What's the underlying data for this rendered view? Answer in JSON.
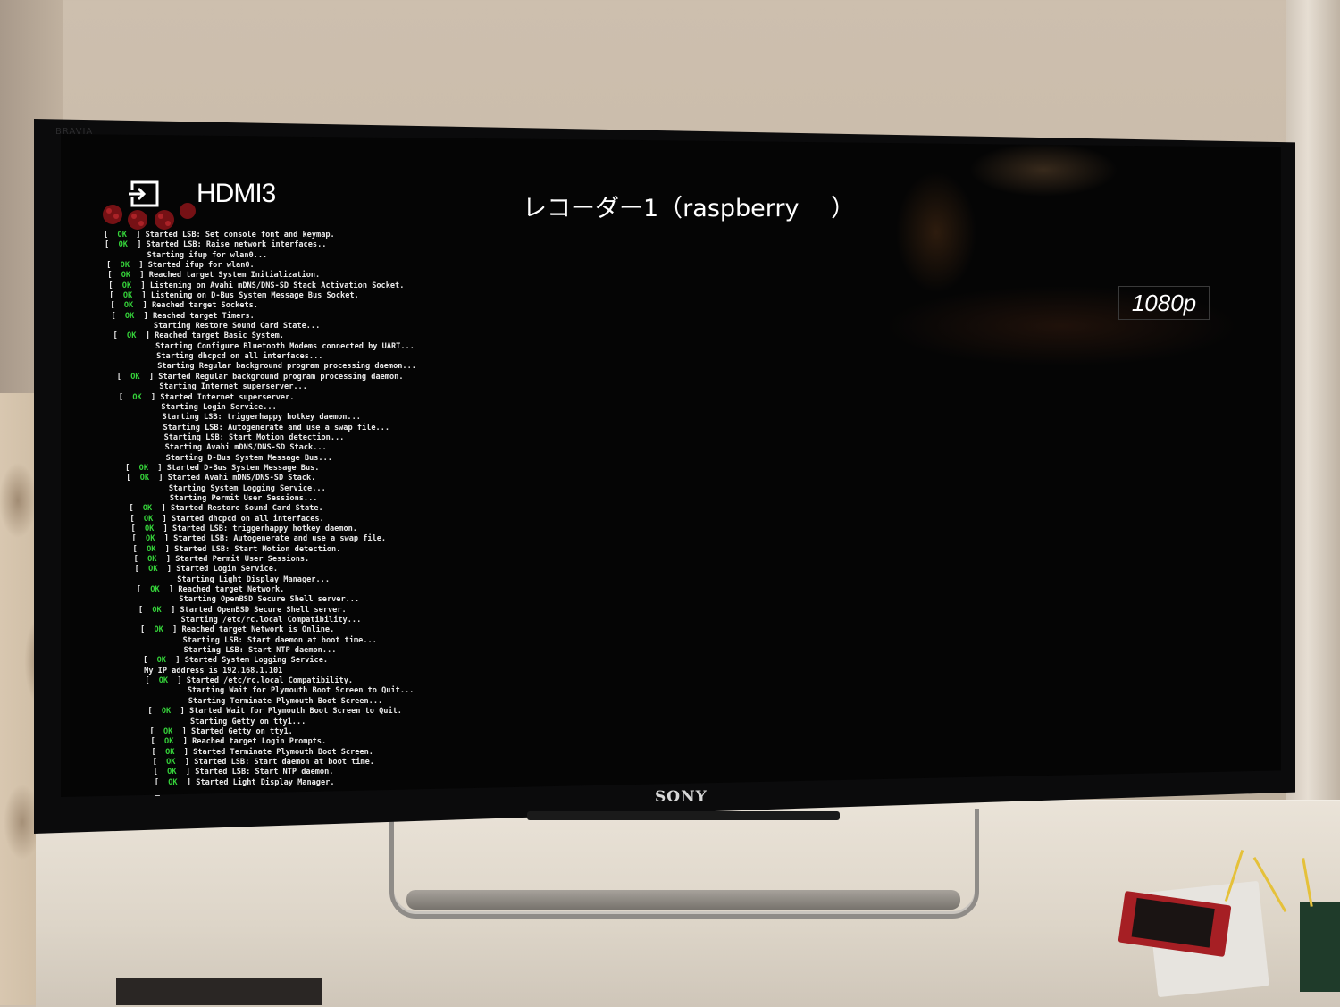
{
  "tv": {
    "brand": "SONY",
    "top_brand": "BRAVIA"
  },
  "osd": {
    "input_label": "HDMI3",
    "channel_title": "レコーダー1（raspberry　 ）",
    "resolution": "1080p",
    "input_icon": "input-source-icon"
  },
  "console": {
    "lines": [
      {
        "ok": true,
        "text": "Started LSB: Set console font and keymap."
      },
      {
        "ok": true,
        "text": "Started LSB: Raise network interfaces.."
      },
      {
        "ok": false,
        "text": "Starting ifup for wlan0..."
      },
      {
        "ok": true,
        "text": "Started ifup for wlan0."
      },
      {
        "ok": true,
        "text": "Reached target System Initialization."
      },
      {
        "ok": true,
        "text": "Listening on Avahi mDNS/DNS-SD Stack Activation Socket."
      },
      {
        "ok": true,
        "text": "Listening on D-Bus System Message Bus Socket."
      },
      {
        "ok": true,
        "text": "Reached target Sockets."
      },
      {
        "ok": true,
        "text": "Reached target Timers."
      },
      {
        "ok": false,
        "text": "Starting Restore Sound Card State..."
      },
      {
        "ok": true,
        "text": "Reached target Basic System."
      },
      {
        "ok": false,
        "text": "Starting Configure Bluetooth Modems connected by UART..."
      },
      {
        "ok": false,
        "text": "Starting dhcpcd on all interfaces..."
      },
      {
        "ok": false,
        "text": "Starting Regular background program processing daemon..."
      },
      {
        "ok": true,
        "text": "Started Regular background program processing daemon."
      },
      {
        "ok": false,
        "text": "Starting Internet superserver..."
      },
      {
        "ok": true,
        "text": "Started Internet superserver."
      },
      {
        "ok": false,
        "text": "Starting Login Service..."
      },
      {
        "ok": false,
        "text": "Starting LSB: triggerhappy hotkey daemon..."
      },
      {
        "ok": false,
        "text": "Starting LSB: Autogenerate and use a swap file..."
      },
      {
        "ok": false,
        "text": "Starting LSB: Start Motion detection..."
      },
      {
        "ok": false,
        "text": "Starting Avahi mDNS/DNS-SD Stack..."
      },
      {
        "ok": false,
        "text": "Starting D-Bus System Message Bus..."
      },
      {
        "ok": true,
        "text": "Started D-Bus System Message Bus."
      },
      {
        "ok": true,
        "text": "Started Avahi mDNS/DNS-SD Stack."
      },
      {
        "ok": false,
        "text": "Starting System Logging Service..."
      },
      {
        "ok": false,
        "text": "Starting Permit User Sessions..."
      },
      {
        "ok": true,
        "text": "Started Restore Sound Card State."
      },
      {
        "ok": true,
        "text": "Started dhcpcd on all interfaces."
      },
      {
        "ok": true,
        "text": "Started LSB: triggerhappy hotkey daemon."
      },
      {
        "ok": true,
        "text": "Started LSB: Autogenerate and use a swap file."
      },
      {
        "ok": true,
        "text": "Started LSB: Start Motion detection."
      },
      {
        "ok": true,
        "text": "Started Permit User Sessions."
      },
      {
        "ok": true,
        "text": "Started Login Service."
      },
      {
        "ok": false,
        "text": "Starting Light Display Manager..."
      },
      {
        "ok": true,
        "text": "Reached target Network."
      },
      {
        "ok": false,
        "text": "Starting OpenBSD Secure Shell server..."
      },
      {
        "ok": true,
        "text": "Started OpenBSD Secure Shell server."
      },
      {
        "ok": false,
        "text": "Starting /etc/rc.local Compatibility..."
      },
      {
        "ok": true,
        "text": "Reached target Network is Online."
      },
      {
        "ok": false,
        "text": "Starting LSB: Start daemon at boot time..."
      },
      {
        "ok": false,
        "text": "Starting LSB: Start NTP daemon..."
      },
      {
        "ok": true,
        "text": "Started System Logging Service."
      },
      {
        "ok": null,
        "text": "My IP address is 192.168.1.101"
      },
      {
        "ok": true,
        "text": "Started /etc/rc.local Compatibility."
      },
      {
        "ok": false,
        "text": "Starting Wait for Plymouth Boot Screen to Quit..."
      },
      {
        "ok": false,
        "text": "Starting Terminate Plymouth Boot Screen..."
      },
      {
        "ok": true,
        "text": "Started Wait for Plymouth Boot Screen to Quit."
      },
      {
        "ok": false,
        "text": "Starting Getty on tty1..."
      },
      {
        "ok": true,
        "text": "Started Getty on tty1."
      },
      {
        "ok": true,
        "text": "Reached target Login Prompts."
      },
      {
        "ok": true,
        "text": "Started Terminate Plymouth Boot Screen."
      },
      {
        "ok": true,
        "text": "Started LSB: Start daemon at boot time."
      },
      {
        "ok": true,
        "text": "Started LSB: Start NTP daemon."
      },
      {
        "ok": true,
        "text": "Started Light Display Manager."
      },
      {
        "ok": null,
        "text": "_"
      }
    ],
    "ok_tag": "OK",
    "ok_color": "#35d33a",
    "text_color": "#e9e9e9"
  }
}
